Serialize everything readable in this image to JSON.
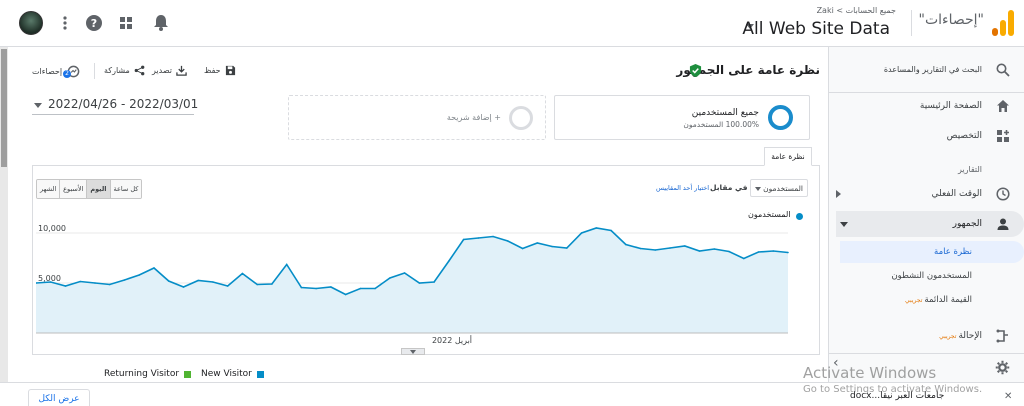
{
  "header": {
    "property_title": "\"إحصاءات\"",
    "breadcrumb_user": "Zaki",
    "breadcrumb_link": "جميع الحسابات",
    "view_title": "All Web Site Data",
    "icons": [
      "bell-icon",
      "apps-grid-icon",
      "help-icon",
      "more-vert-icon"
    ]
  },
  "sidebar": {
    "search": "البحث في التقارير والمساعدة",
    "home": "الصفحة الرئيسية",
    "customization": "التخصيص",
    "reports_section": "التقارير",
    "realtime": "الوقت الفعلي",
    "audience": "الجمهور",
    "overview": "نظرة عامة",
    "active_users": "المستخدمون النشطون",
    "lifetime_value": "القيمة الدائمة",
    "beta": "تجريبي",
    "acquisition": "الإحالة",
    "settings": "الإعدادات"
  },
  "page": {
    "title": "نظرة عامة على الجمهور",
    "toolbar": {
      "save": "حفظ",
      "export": "تصدير",
      "share": "مشاركة",
      "insights": "إحصاءات",
      "insights_badge": "2"
    },
    "date_range": "2022/04/26 - 2022/03/01",
    "segment_name": "جميع المستخدمين",
    "segment_pct": "100.00% المستخدمون",
    "add_segment": "+ إضافة شريحة",
    "tab": "نظرة عامة",
    "metric": "المستخدمون",
    "vs": "في مقابل",
    "pick_metric": "اختيار أحد المقاييس",
    "periods": {
      "hourly": "كل ساعة",
      "day": "اليوم",
      "week": "الأسبوع",
      "month": "الشهر"
    },
    "chart_legend": "المستخدمون"
  },
  "chart_data": {
    "type": "area",
    "series": [
      {
        "name": "المستخدمون",
        "values": [
          5000,
          5100,
          4700,
          5150,
          5000,
          4850,
          5300,
          5800,
          6500,
          5200,
          4600,
          5250,
          5100,
          4700,
          5950,
          4850,
          4900,
          6850,
          4550,
          4450,
          4600,
          3850,
          4450,
          4450,
          5500,
          6000,
          5000,
          5100,
          7200,
          9350,
          9500,
          9650,
          9200,
          8450,
          9000,
          8650,
          8500,
          10000,
          10500,
          10250,
          8850,
          8450,
          8300,
          8500,
          8700,
          8200,
          8400,
          8150,
          7450,
          8100,
          8200,
          8050
        ]
      }
    ],
    "color": "#058dc7",
    "fill": "#e1f1f9",
    "y_ticks": [
      "10,000",
      "5,000"
    ],
    "ylim": [
      0,
      11000
    ],
    "x_label": "أبريل 2022",
    "grid": true
  },
  "visitor_legend": {
    "returning": "Returning Visitor",
    "returning_color": "#50b432",
    "new": "New Visitor",
    "new_color": "#058dc7"
  },
  "bottom": {
    "show_all": "عرض الكل",
    "download": "جامعات العبر نيقا...docx"
  },
  "watermark": {
    "line1": "Activate Windows",
    "line2": "Go to Settings to activate Windows."
  }
}
